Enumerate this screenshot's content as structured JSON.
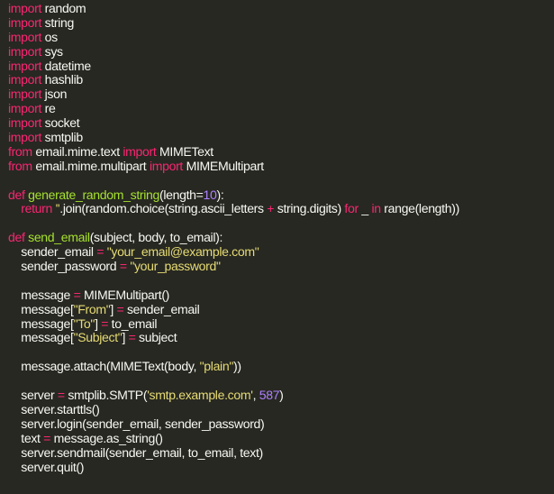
{
  "code_editor": {
    "theme_colors": {
      "background": "#272822",
      "text": "#f8f8f2",
      "keyword": "#f92672",
      "function_name": "#a6e22e",
      "string": "#e6db74",
      "number": "#ae81ff"
    },
    "lines": [
      [
        {
          "t": "import",
          "c": "kw"
        },
        {
          "t": " random",
          "c": "id"
        }
      ],
      [
        {
          "t": "import",
          "c": "kw"
        },
        {
          "t": " string",
          "c": "id"
        }
      ],
      [
        {
          "t": "import",
          "c": "kw"
        },
        {
          "t": " os",
          "c": "id"
        }
      ],
      [
        {
          "t": "import",
          "c": "kw"
        },
        {
          "t": " sys",
          "c": "id"
        }
      ],
      [
        {
          "t": "import",
          "c": "kw"
        },
        {
          "t": " datetime",
          "c": "id"
        }
      ],
      [
        {
          "t": "import",
          "c": "kw"
        },
        {
          "t": " hashlib",
          "c": "id"
        }
      ],
      [
        {
          "t": "import",
          "c": "kw"
        },
        {
          "t": " json",
          "c": "id"
        }
      ],
      [
        {
          "t": "import",
          "c": "kw"
        },
        {
          "t": " re",
          "c": "id"
        }
      ],
      [
        {
          "t": "import",
          "c": "kw"
        },
        {
          "t": " socket",
          "c": "id"
        }
      ],
      [
        {
          "t": "import",
          "c": "kw"
        },
        {
          "t": " smtplib",
          "c": "id"
        }
      ],
      [
        {
          "t": "from",
          "c": "kw"
        },
        {
          "t": " email.mime.text ",
          "c": "id"
        },
        {
          "t": "import",
          "c": "kw"
        },
        {
          "t": " MIMEText",
          "c": "id"
        }
      ],
      [
        {
          "t": "from",
          "c": "kw"
        },
        {
          "t": " email.mime.multipart ",
          "c": "id"
        },
        {
          "t": "import",
          "c": "kw"
        },
        {
          "t": " MIMEMultipart",
          "c": "id"
        }
      ],
      [],
      [
        {
          "t": "def",
          "c": "kw"
        },
        {
          "t": " ",
          "c": "id"
        },
        {
          "t": "generate_random_string",
          "c": "fn"
        },
        {
          "t": "(length=",
          "c": "id"
        },
        {
          "t": "10",
          "c": "num"
        },
        {
          "t": "):",
          "c": "id"
        }
      ],
      [
        {
          "t": "    ",
          "c": "id"
        },
        {
          "t": "return",
          "c": "kw"
        },
        {
          "t": " ",
          "c": "id"
        },
        {
          "t": "''",
          "c": "str"
        },
        {
          "t": ".join(random.choice(string.ascii_letters ",
          "c": "id"
        },
        {
          "t": "+",
          "c": "kw"
        },
        {
          "t": " string.digits) ",
          "c": "id"
        },
        {
          "t": "for",
          "c": "kw"
        },
        {
          "t": " _ ",
          "c": "id"
        },
        {
          "t": "in",
          "c": "kw"
        },
        {
          "t": " range(length))",
          "c": "id"
        }
      ],
      [],
      [
        {
          "t": "def",
          "c": "kw"
        },
        {
          "t": " ",
          "c": "id"
        },
        {
          "t": "send_email",
          "c": "fn"
        },
        {
          "t": "(subject, body, to_email):",
          "c": "id"
        }
      ],
      [
        {
          "t": "    sender_email ",
          "c": "id"
        },
        {
          "t": "=",
          "c": "kw"
        },
        {
          "t": " ",
          "c": "id"
        },
        {
          "t": "\"your_email@example.com\"",
          "c": "str"
        }
      ],
      [
        {
          "t": "    sender_password ",
          "c": "id"
        },
        {
          "t": "=",
          "c": "kw"
        },
        {
          "t": " ",
          "c": "id"
        },
        {
          "t": "\"your_password\"",
          "c": "str"
        }
      ],
      [],
      [
        {
          "t": "    message ",
          "c": "id"
        },
        {
          "t": "=",
          "c": "kw"
        },
        {
          "t": " MIMEMultipart()",
          "c": "id"
        }
      ],
      [
        {
          "t": "    message[",
          "c": "id"
        },
        {
          "t": "\"From\"",
          "c": "str"
        },
        {
          "t": "] ",
          "c": "id"
        },
        {
          "t": "=",
          "c": "kw"
        },
        {
          "t": " sender_email",
          "c": "id"
        }
      ],
      [
        {
          "t": "    message[",
          "c": "id"
        },
        {
          "t": "\"To\"",
          "c": "str"
        },
        {
          "t": "] ",
          "c": "id"
        },
        {
          "t": "=",
          "c": "kw"
        },
        {
          "t": " to_email",
          "c": "id"
        }
      ],
      [
        {
          "t": "    message[",
          "c": "id"
        },
        {
          "t": "\"Subject\"",
          "c": "str"
        },
        {
          "t": "] ",
          "c": "id"
        },
        {
          "t": "=",
          "c": "kw"
        },
        {
          "t": " subject",
          "c": "id"
        }
      ],
      [],
      [
        {
          "t": "    message.attach(MIMEText(body, ",
          "c": "id"
        },
        {
          "t": "\"plain\"",
          "c": "str"
        },
        {
          "t": "))",
          "c": "id"
        }
      ],
      [],
      [
        {
          "t": "    server ",
          "c": "id"
        },
        {
          "t": "=",
          "c": "kw"
        },
        {
          "t": " smtplib.SMTP(",
          "c": "id"
        },
        {
          "t": "'smtp.example.com'",
          "c": "str"
        },
        {
          "t": ", ",
          "c": "id"
        },
        {
          "t": "587",
          "c": "num"
        },
        {
          "t": ")",
          "c": "id"
        }
      ],
      [
        {
          "t": "    server.starttls()",
          "c": "id"
        }
      ],
      [
        {
          "t": "    server.login(sender_email, sender_password)",
          "c": "id"
        }
      ],
      [
        {
          "t": "    text ",
          "c": "id"
        },
        {
          "t": "=",
          "c": "kw"
        },
        {
          "t": " message.as_string()",
          "c": "id"
        }
      ],
      [
        {
          "t": "    server.sendmail(sender_email, to_email, text)",
          "c": "id"
        }
      ],
      [
        {
          "t": "    server.quit()",
          "c": "id"
        }
      ]
    ]
  }
}
